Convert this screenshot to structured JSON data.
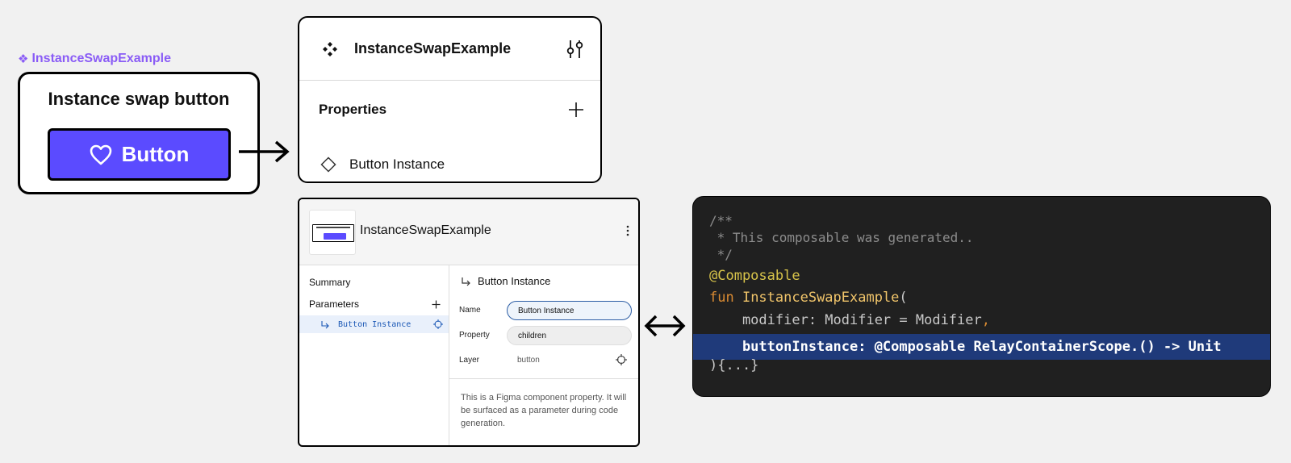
{
  "component": {
    "label": "InstanceSwapExample",
    "preview_title": "Instance swap button",
    "button_label": "Button"
  },
  "properties_panel": {
    "title": "InstanceSwapExample",
    "section_label": "Properties",
    "property_name": "Button Instance"
  },
  "relay_panel": {
    "title": "InstanceSwapExample",
    "nav": {
      "summary": "Summary",
      "parameters": "Parameters",
      "parameter_item": "Button Instance"
    },
    "detail": {
      "title": "Button Instance",
      "name_label": "Name",
      "name_value": "Button Instance",
      "property_label": "Property",
      "property_value": "children",
      "layer_label": "Layer",
      "layer_value": "button",
      "description": "This is a Figma component property. It will be surfaced as a parameter during code generation."
    }
  },
  "code": {
    "line_0": "/**",
    "line_1": " * This composable was generated..",
    "line_2": " */",
    "annotation": "@Composable",
    "fun_keyword": "fun ",
    "fun_name": "InstanceSwapExample",
    "fun_open": "(",
    "param_1_text": "    modifier: Modifier = Modifier",
    "param_1_comma": ",",
    "param_2": "    buttonInstance: @Composable RelayContainerScope.() -> Unit",
    "closing": "){...}"
  },
  "colors": {
    "accent_purple": "#5b4bff",
    "label_purple": "#8a5cf6",
    "code_background": "#202020",
    "code_highlight": "#1f3a7a"
  }
}
